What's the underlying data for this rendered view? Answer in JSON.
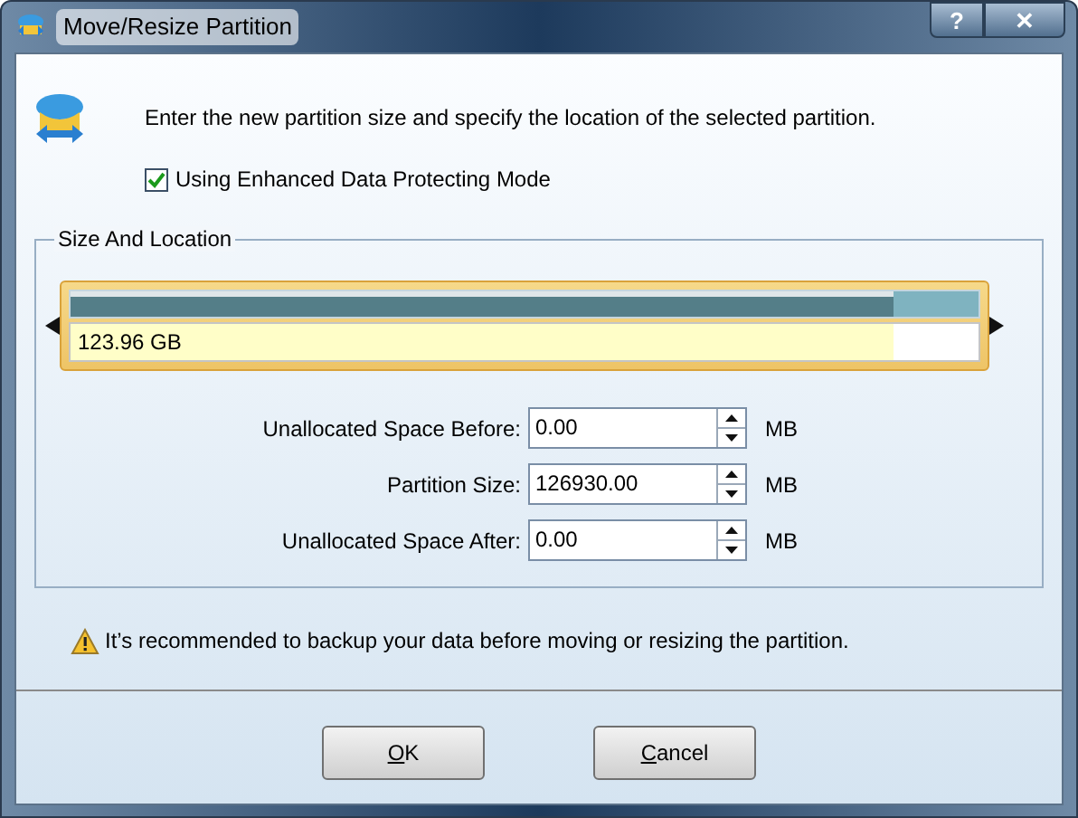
{
  "window": {
    "title": "Move/Resize Partition",
    "buttons": [
      "?",
      "✕"
    ]
  },
  "instruction": "Enter the new partition size and specify the location of the selected partition.",
  "protect_mode": {
    "label": "Using Enhanced Data Protecting Mode",
    "checked": true
  },
  "group": {
    "title": "Size And Location",
    "partition": {
      "size": "123.96 GB",
      "level": 0.906
    },
    "fields": [
      {
        "label": "Unallocated Space Before:",
        "value": "0.00",
        "unit": "MB"
      },
      {
        "label": "Partition Size:",
        "value": "126930.00",
        "unit": "MB"
      },
      {
        "label": "Unallocated Space After:",
        "value": "0.00",
        "unit": "MB"
      }
    ]
  },
  "warning": "It’s recommended to backup your data before moving or resizing the partition.",
  "buttons": [
    "OK",
    "Cancel"
  ]
}
